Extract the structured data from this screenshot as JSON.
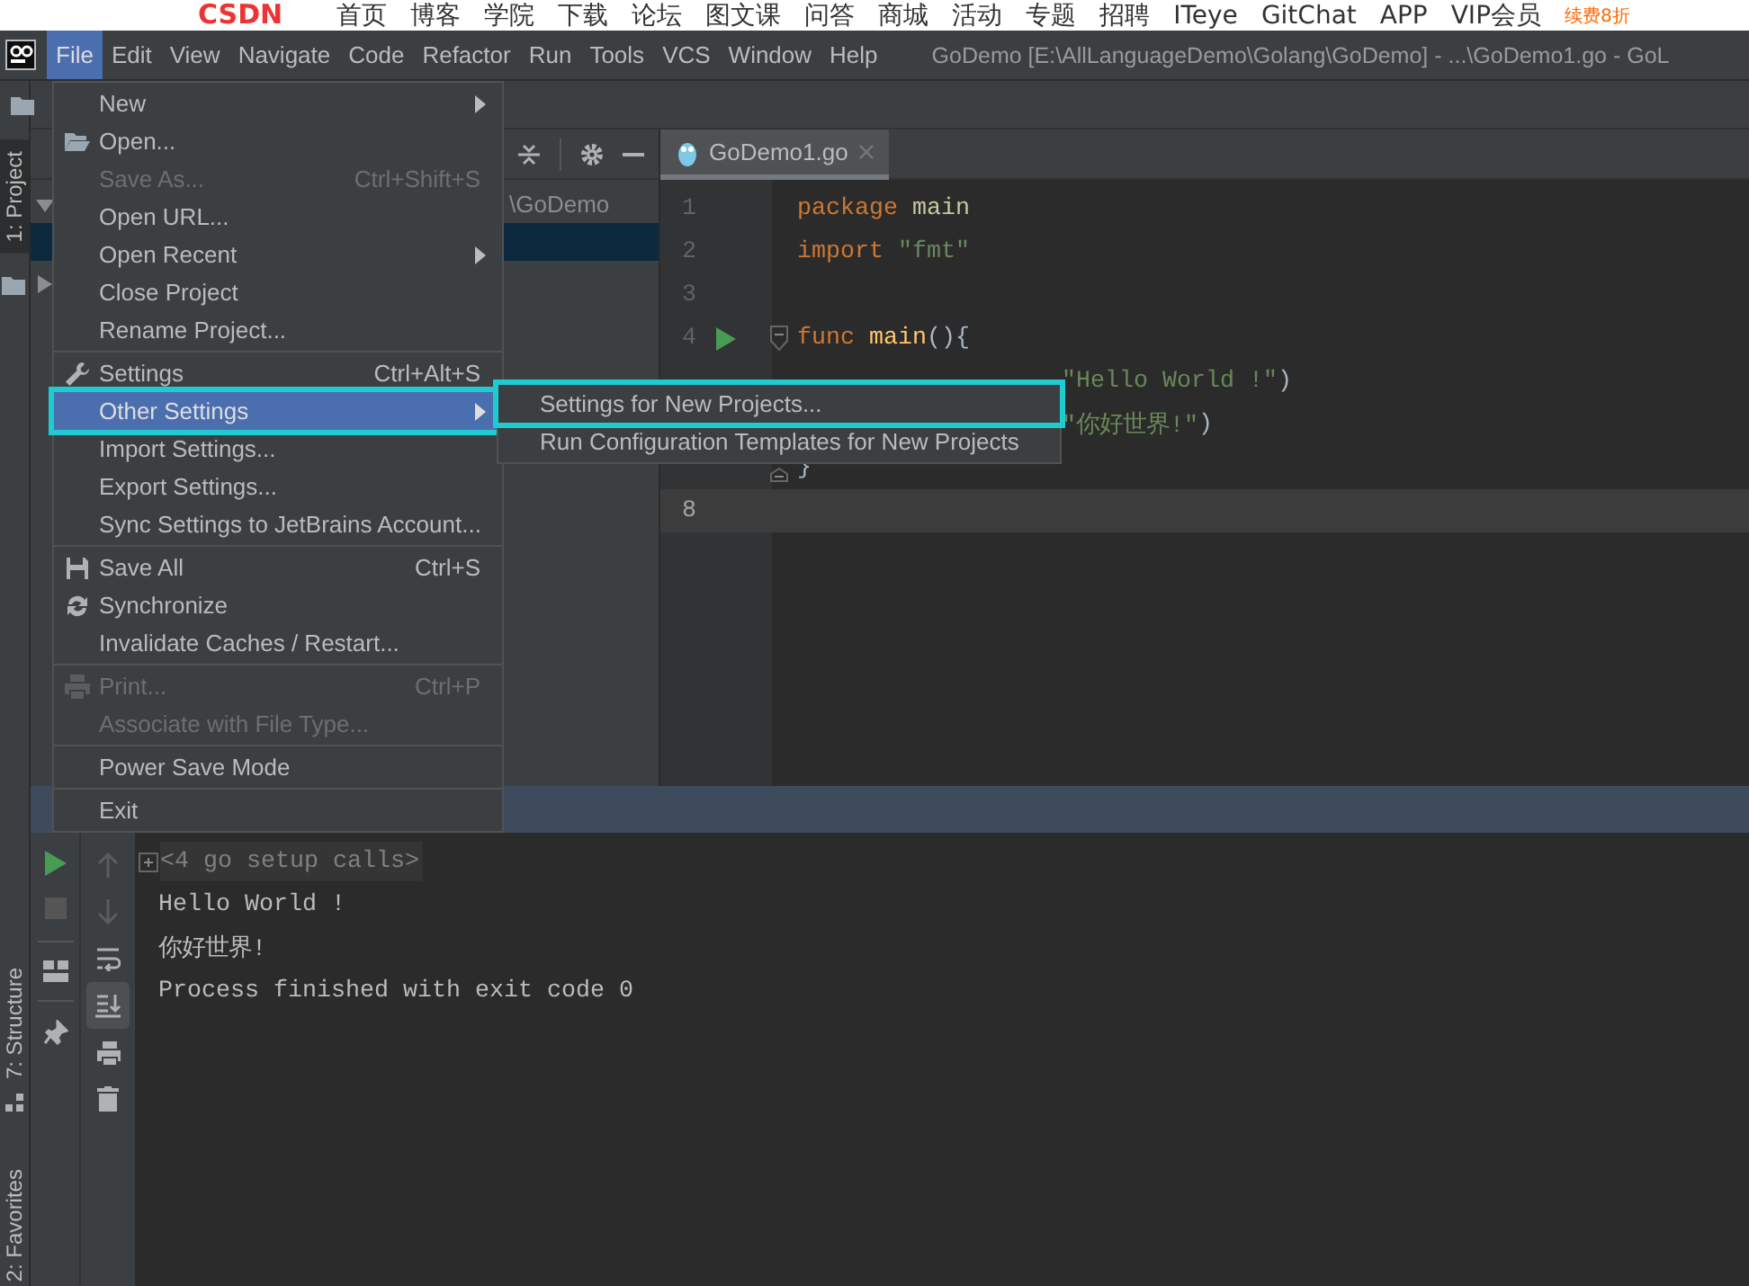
{
  "csdn_bar": {
    "logo": "CSDN",
    "links": [
      "首页",
      "博客",
      "学院",
      "下载",
      "论坛",
      "图文课",
      "问答",
      "商城",
      "活动",
      "专题",
      "招聘",
      "ITeye",
      "GitChat",
      "APP",
      "VIP会员"
    ],
    "promo": "续费8折"
  },
  "menu_bar": {
    "items": [
      {
        "label": "File",
        "selected": true
      },
      {
        "label": "Edit",
        "selected": false
      },
      {
        "label": "View",
        "selected": false
      },
      {
        "label": "Navigate",
        "selected": false
      },
      {
        "label": "Code",
        "selected": false
      },
      {
        "label": "Refactor",
        "selected": false
      },
      {
        "label": "Run",
        "selected": false
      },
      {
        "label": "Tools",
        "selected": false
      },
      {
        "label": "VCS",
        "selected": false
      },
      {
        "label": "Window",
        "selected": false
      },
      {
        "label": "Help",
        "selected": false
      }
    ],
    "title": "GoDemo [E:\\AllLanguageDemo\\Golang\\GoDemo] - ...\\GoDemo1.go - GoL"
  },
  "tool_strip": {
    "top": [
      {
        "label": "1: Project",
        "selected": true
      }
    ],
    "bottom": [
      {
        "label": "7: Structure",
        "selected": false
      },
      {
        "label": "2: Favorites",
        "selected": false
      }
    ]
  },
  "project": {
    "rows": [
      {
        "label": "\\GoDemo",
        "expanded": true,
        "selected": false
      },
      {
        "selected": true
      },
      {
        "expanded": false,
        "selected": false
      }
    ]
  },
  "editor": {
    "tab": {
      "label": "GoDemo1.go",
      "selected": true
    },
    "lines": [
      {
        "number": "1",
        "current": false,
        "tokens": [
          {
            "kind": "keyword",
            "text": "package"
          },
          {
            "kind": "ident",
            "text": " main"
          }
        ]
      },
      {
        "number": "2",
        "current": false,
        "tokens": [
          {
            "kind": "keyword",
            "text": "import"
          },
          {
            "kind": "string",
            "text": " \"fmt\""
          }
        ]
      },
      {
        "number": "3",
        "current": false
      },
      {
        "number": "4",
        "current": false,
        "run": true,
        "fold_open": true,
        "tokens": [
          {
            "kind": "keyword",
            "text": "func"
          },
          {
            "kind": "func",
            "text": " main"
          },
          {
            "kind": "plain",
            "text": "(){"
          }
        ]
      },
      {
        "current": false,
        "covered": true,
        "tokens": [
          {
            "kind": "string",
            "text": "\"Hello World !\""
          },
          {
            "kind": "plain",
            "text": ")"
          }
        ]
      },
      {
        "current": false,
        "covered": true,
        "tokens": [
          {
            "kind": "string",
            "text": "\"你好世界!\""
          },
          {
            "kind": "plain",
            "text": ")"
          }
        ]
      },
      {
        "current": false,
        "fold_close": true,
        "tokens": [
          {
            "kind": "plain",
            "text": "}"
          }
        ]
      },
      {
        "number": "8",
        "current": true
      }
    ]
  },
  "run_panel": {
    "scroll_to_end_on": true,
    "console": [
      {
        "kind": "folded",
        "text": "<4 go setup calls>"
      },
      {
        "kind": "output",
        "text": "Hello World !"
      },
      {
        "kind": "output",
        "text": "你好世界!"
      },
      {
        "kind": "output",
        "text": "Process finished with exit code 0"
      }
    ]
  },
  "file_menu": {
    "groups": [
      [
        {
          "label": "New",
          "submenu": true,
          "disabled": false,
          "selected": false,
          "highlighted": false
        },
        {
          "label": "Open...",
          "disabled": false,
          "selected": false,
          "highlighted": false
        },
        {
          "label": "Save As...",
          "shortcut": "Ctrl+Shift+S",
          "disabled": true,
          "selected": false,
          "highlighted": false
        },
        {
          "label": "Open URL...",
          "disabled": false,
          "selected": false,
          "highlighted": false
        },
        {
          "label": "Open Recent",
          "submenu": true,
          "disabled": false,
          "selected": false,
          "highlighted": false
        },
        {
          "label": "Close Project",
          "disabled": false,
          "selected": false,
          "highlighted": false
        },
        {
          "label": "Rename Project...",
          "disabled": false,
          "selected": false,
          "highlighted": false
        }
      ],
      [
        {
          "label": "Settings",
          "shortcut": "Ctrl+Alt+S",
          "disabled": false,
          "selected": false,
          "highlighted": false
        },
        {
          "label": "Other Settings",
          "submenu": true,
          "disabled": false,
          "selected": true,
          "highlighted": true
        },
        {
          "label": "Import Settings...",
          "disabled": false,
          "selected": false,
          "highlighted": false
        },
        {
          "label": "Export Settings...",
          "disabled": false,
          "selected": false,
          "highlighted": false
        },
        {
          "label": "Sync Settings to JetBrains Account...",
          "disabled": false,
          "selected": false,
          "highlighted": false
        }
      ],
      [
        {
          "label": "Save All",
          "shortcut": "Ctrl+S",
          "disabled": false,
          "selected": false,
          "highlighted": false
        },
        {
          "label": "Synchronize",
          "disabled": false,
          "selected": false,
          "highlighted": false
        },
        {
          "label": "Invalidate Caches / Restart...",
          "disabled": false,
          "selected": false,
          "highlighted": false
        }
      ],
      [
        {
          "label": "Print...",
          "shortcut": "Ctrl+P",
          "disabled": true,
          "selected": false,
          "highlighted": false
        },
        {
          "label": "Associate with File Type...",
          "disabled": true,
          "selected": false,
          "highlighted": false
        }
      ],
      [
        {
          "label": "Power Save Mode",
          "disabled": false,
          "selected": false,
          "highlighted": false
        }
      ],
      [
        {
          "label": "Exit",
          "disabled": false,
          "selected": false,
          "highlighted": false
        }
      ]
    ]
  },
  "submenu": {
    "items": [
      {
        "label": "Settings for New Projects...",
        "selected": false,
        "highlighted": true
      },
      {
        "label": "Run Configuration Templates for New Projects",
        "selected": false,
        "highlighted": false
      }
    ]
  }
}
